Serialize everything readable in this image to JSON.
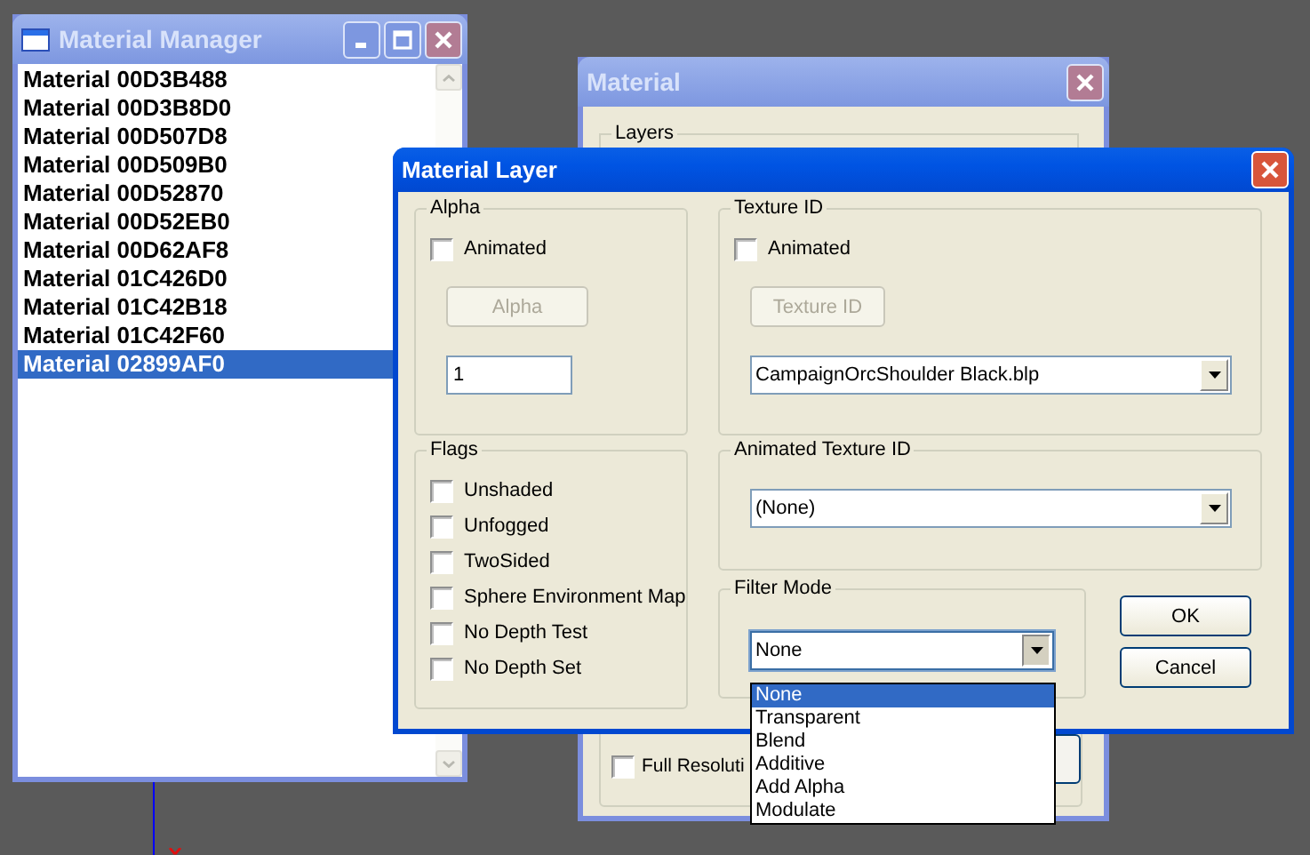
{
  "material_manager": {
    "title": "Material Manager",
    "active": false,
    "items": [
      {
        "label": "Material 00D3B488",
        "selected": false
      },
      {
        "label": "Material 00D3B8D0",
        "selected": false
      },
      {
        "label": "Material 00D507D8",
        "selected": false
      },
      {
        "label": "Material 00D509B0",
        "selected": false
      },
      {
        "label": "Material 00D52870",
        "selected": false
      },
      {
        "label": "Material 00D52EB0",
        "selected": false
      },
      {
        "label": "Material 00D62AF8",
        "selected": false
      },
      {
        "label": "Material 01C426D0",
        "selected": false
      },
      {
        "label": "Material 01C42B18",
        "selected": false
      },
      {
        "label": "Material 01C42F60",
        "selected": false
      },
      {
        "label": "Material 02899AF0",
        "selected": true
      }
    ]
  },
  "material_window": {
    "title": "Material",
    "active": false,
    "layers_label": "Layers",
    "full_resolution": {
      "label": "Full Resoluti",
      "checked": false
    }
  },
  "material_layer": {
    "title": "Material Layer",
    "active": true,
    "alpha": {
      "label": "Alpha",
      "animated": {
        "label": "Animated",
        "checked": false
      },
      "button": {
        "label": "Alpha",
        "disabled": true
      },
      "value": "1"
    },
    "texture_id": {
      "label": "Texture ID",
      "animated": {
        "label": "Animated",
        "checked": false
      },
      "button": {
        "label": "Texture ID",
        "disabled": true
      },
      "value": "CampaignOrcShoulder Black.blp"
    },
    "flags": {
      "label": "Flags",
      "items": [
        {
          "label": "Unshaded",
          "checked": false
        },
        {
          "label": "Unfogged",
          "checked": false
        },
        {
          "label": "TwoSided",
          "checked": false
        },
        {
          "label": "Sphere Environment Map",
          "checked": false
        },
        {
          "label": "No Depth Test",
          "checked": false
        },
        {
          "label": "No Depth Set",
          "checked": false
        }
      ]
    },
    "animated_texture_id": {
      "label": "Animated Texture ID",
      "value": "(None)"
    },
    "filter_mode": {
      "label": "Filter Mode",
      "value": "None",
      "expanded": true,
      "options": [
        {
          "label": "None",
          "selected": true
        },
        {
          "label": "Transparent",
          "selected": false
        },
        {
          "label": "Blend",
          "selected": false
        },
        {
          "label": "Additive",
          "selected": false
        },
        {
          "label": "Add Alpha",
          "selected": false
        },
        {
          "label": "Modulate",
          "selected": false
        }
      ]
    },
    "buttons": [
      "OK",
      "Cancel"
    ]
  }
}
